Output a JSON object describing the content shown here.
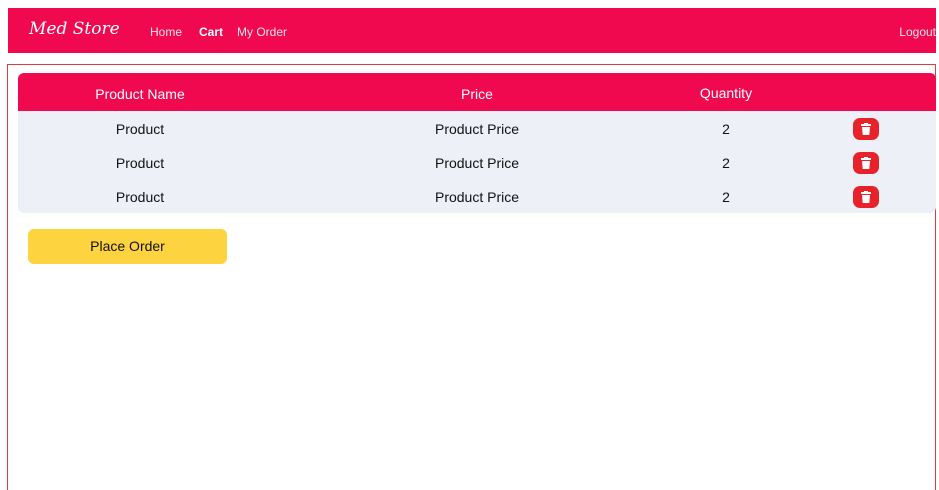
{
  "navbar": {
    "brand": "Med Store",
    "links": [
      {
        "label": "Home",
        "active": false
      },
      {
        "label": "Cart",
        "active": true
      },
      {
        "label": "My Order",
        "active": false
      }
    ],
    "logout": "Logout"
  },
  "cart": {
    "columns": [
      "Product Name",
      "Price",
      "Quantity"
    ],
    "rows": [
      {
        "name": "Product",
        "price": "Product Price",
        "quantity": "2",
        "action_icon": "trash-icon"
      },
      {
        "name": "Product",
        "price": "Product Price",
        "quantity": "2",
        "action_icon": "trash-icon"
      },
      {
        "name": "Product",
        "price": "Product Price",
        "quantity": "2",
        "action_icon": "trash-icon"
      }
    ]
  },
  "actions": {
    "place_order": "Place Order"
  },
  "colors": {
    "primary": "#f0094f",
    "delete": "#e8222b",
    "button": "#fdd33f",
    "table_body": "#eef0f8"
  }
}
